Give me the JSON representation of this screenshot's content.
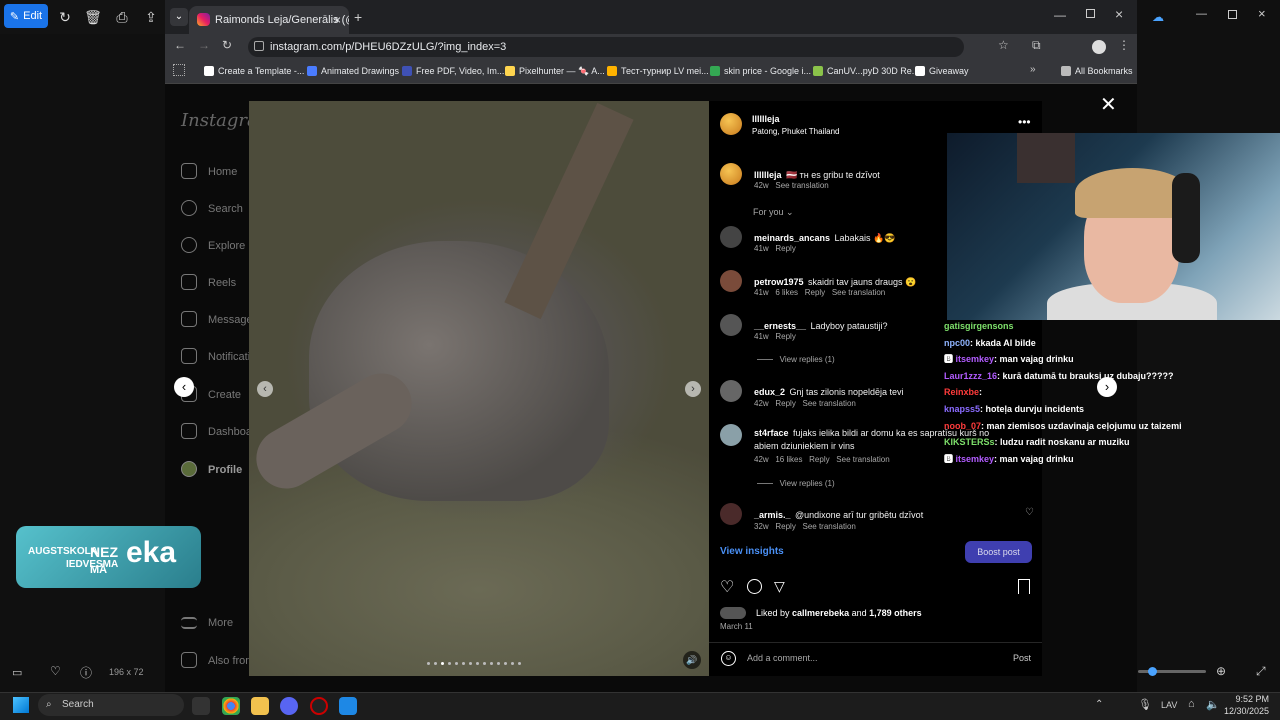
{
  "photos_app": {
    "edit_label": "Edit",
    "image_size": "196 x 72"
  },
  "browser": {
    "tab_title": "Raimonds Leja/Generālis (@lllll",
    "url": "instagram.com/p/DHEU6DZzULG/?img_index=3",
    "bookmarks": [
      {
        "label": "Create a Template -...",
        "color": "#ffffff"
      },
      {
        "label": "Animated Drawings",
        "color": "#4a7cff"
      },
      {
        "label": "Free PDF, Video, Im...",
        "color": "#3f51b5"
      },
      {
        "label": "Pixelhunter — 🍬 A...",
        "color": "#ffd54f"
      },
      {
        "label": "Тест-турнир LV mei...",
        "color": "#ffb300"
      },
      {
        "label": "skin price - Google i...",
        "color": "#34a853"
      },
      {
        "label": "CanUV...pyD 30D Re...",
        "color": "#8bc34a"
      },
      {
        "label": "Giveaway",
        "color": "#ffffff"
      }
    ],
    "all_bookmarks": "All Bookmarks"
  },
  "instagram": {
    "logo": "Instagram",
    "nav": [
      "Home",
      "Search",
      "Explore",
      "Reels",
      "Messages",
      "Notifications",
      "Create",
      "Dashboard",
      "Profile",
      "More",
      "Also from Meta"
    ],
    "post": {
      "username": "lllllleja",
      "location": "Patong, Phuket Thailand",
      "caption": "🇱🇻 тн es gribu te dzīvot",
      "caption_time": "42w",
      "see_translation": "See translation",
      "for_you": "For you",
      "comments": [
        {
          "user": "meinards_ancans",
          "text": "Labakais 🔥😎",
          "time": "41w",
          "likes": "",
          "translate": false
        },
        {
          "user": "petrow1975",
          "text": "skaidri tav jauns draugs 😮",
          "time": "41w",
          "likes": "6 likes",
          "translate": true
        },
        {
          "user": "__ernests__",
          "text": "Ladyboy pataustiji?",
          "time": "41w",
          "likes": "",
          "translate": false,
          "replies": "View replies (1)"
        },
        {
          "user": "edux_2",
          "text": "Gnj tas zilonis nopeldēja tevi",
          "time": "42w",
          "likes": "",
          "translate": true
        },
        {
          "user": "st4rface",
          "text": "fujaks ielika bildi ar domu ka es sapratīsu kurš no abiem dziuniekiem ir vins",
          "time": "42w",
          "likes": "16 likes",
          "translate": true,
          "replies": "View replies (1)"
        },
        {
          "user": "_armis._",
          "text": "@undixone arī tur gribētu dzīvot",
          "time": "32w",
          "likes": "",
          "translate": true
        }
      ],
      "reply": "Reply",
      "view_insights": "View insights",
      "boost_post": "Boost post",
      "liked_by_prefix": "Liked by",
      "liked_by_user": "callmerebeka",
      "liked_by_and": "and",
      "liked_by_others": "1,789 others",
      "date": "March 11",
      "add_comment": "Add a comment...",
      "post_button": "Post"
    }
  },
  "stream_chat": [
    {
      "user": "gatisgirgensons",
      "msg": "",
      "color": "#7ee06b"
    },
    {
      "user": "npc00",
      "msg": ": kkada AI bilde",
      "color": "#8fb4ff"
    },
    {
      "user": "itsemkey",
      "msg": ": man vajag drinku",
      "color": "#b25cff"
    },
    {
      "user": "Laur1zzz_16",
      "msg": ": kurā datumā tu brauksi uz dubaju?????",
      "color": "#b25cff"
    },
    {
      "user": "Reinxbe",
      "msg": ":",
      "color": "#ff3b3b"
    },
    {
      "user": "knapss5",
      "msg": ": hoteļa durvju incidents",
      "color": "#8a6bff"
    },
    {
      "user": "noob_07",
      "msg": ": man ziemisos uzdavinaja ceļojumu uz taizemi",
      "color": "#ff3b3b"
    },
    {
      "user": "KIKSTERSs",
      "msg": ": ludzu radit noskanu ar muziku",
      "color": "#7ee06b"
    },
    {
      "user": "itsemkey",
      "msg": ": man vajag drinku",
      "color": "#b25cff"
    }
  ],
  "overlay": {
    "line1": "AUGSTSKOLA",
    "line2": "IEDVESMA",
    "big": "NEZ",
    "big2": "eka",
    "mark": "MĀ"
  },
  "taskbar": {
    "search": "Search",
    "lang": "LAV",
    "time": "9:52 PM",
    "date": "12/30/2025"
  }
}
